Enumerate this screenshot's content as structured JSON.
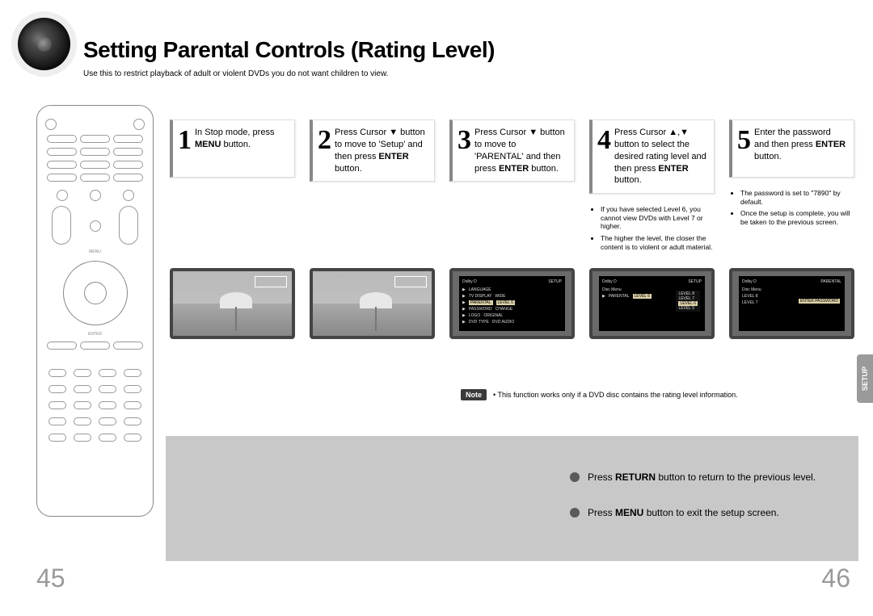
{
  "title": "Setting Parental Controls (Rating Level)",
  "subtitle": "Use this to restrict playback of adult or violent DVDs you do not want children to view.",
  "steps": [
    {
      "num": "1",
      "text": "In Stop mode, press <b>MENU</b> button.",
      "bullets": []
    },
    {
      "num": "2",
      "text": "Press Cursor ▼ button to move to 'Setup' and then press <b>ENTER</b> button.",
      "bullets": []
    },
    {
      "num": "3",
      "text": "Press Cursor ▼ button to move to 'PARENTAL' and then press <b>ENTER</b> button.",
      "bullets": []
    },
    {
      "num": "4",
      "text": "Press Cursor ▲,▼ button to select the desired rating level and then press <b>ENTER</b> button.",
      "bullets": [
        "If you have selected Level 6, you cannot view DVDs with Level 7 or higher.",
        "The higher the level, the closer the content is to violent or adult material."
      ]
    },
    {
      "num": "5",
      "text": "Enter the password and then press <b>ENTER</b> button.",
      "bullets": [
        "The password is set to \"7890\" by default.",
        "Once the setup is complete, you will be taken to the previous screen."
      ]
    }
  ],
  "note_label": "Note",
  "note_text": "• This function works only if a DVD disc contains the rating level information.",
  "setup_tab": "SETUP",
  "bottom_line1_pre": "Press ",
  "bottom_line1_bold": "RETURN",
  "bottom_line1_post": " button to return to the previous level.",
  "bottom_line2_pre": "Press ",
  "bottom_line2_bold": "MENU",
  "bottom_line2_post": " button to exit the setup screen.",
  "page_left": "45",
  "page_right": "46",
  "remote_labels": {
    "enter": "ENTER",
    "menu": "MENU"
  },
  "menu_shot": {
    "header_left": "Dolby D",
    "header_right": "SETUP",
    "rows": [
      [
        "LANGUAGE",
        ""
      ],
      [
        "TV DISPLAY",
        "WIDE"
      ],
      [
        "PARENTAL",
        "LEVEL 6"
      ],
      [
        "PASSWORD",
        "CHANGE"
      ],
      [
        "LOGO",
        "ORIGINAL"
      ],
      [
        "DVD TYPE",
        "DVD AUDIO"
      ]
    ],
    "parental_rows": [
      [
        "Disc Menu",
        ""
      ],
      [
        "PARENTAL",
        "LEVEL 6"
      ]
    ],
    "levels": [
      "LEVEL 8",
      "LEVEL 7",
      "LEVEL 6",
      "LEVEL 5"
    ],
    "password_label": "ENTER PASSWORD"
  }
}
